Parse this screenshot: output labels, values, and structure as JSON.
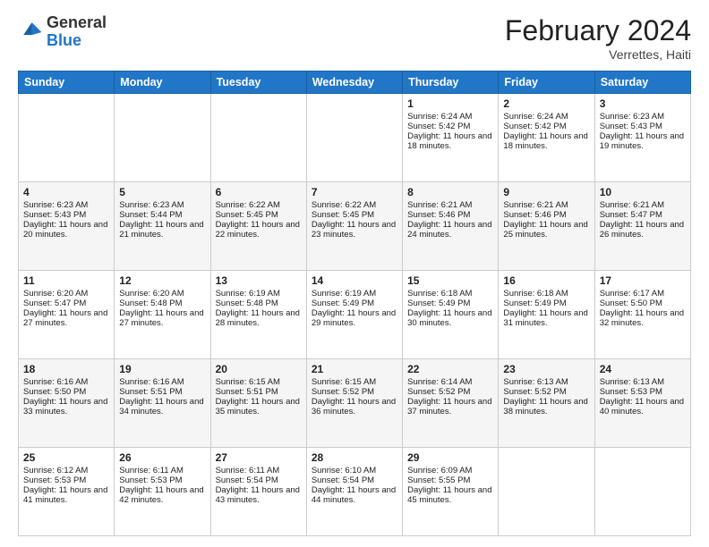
{
  "header": {
    "logo_general": "General",
    "logo_blue": "Blue",
    "title": "February 2024",
    "subtitle": "Verrettes, Haiti"
  },
  "days_of_week": [
    "Sunday",
    "Monday",
    "Tuesday",
    "Wednesday",
    "Thursday",
    "Friday",
    "Saturday"
  ],
  "weeks": [
    [
      {
        "day": "",
        "info": ""
      },
      {
        "day": "",
        "info": ""
      },
      {
        "day": "",
        "info": ""
      },
      {
        "day": "",
        "info": ""
      },
      {
        "day": "1",
        "info": "Sunrise: 6:24 AM\nSunset: 5:42 PM\nDaylight: 11 hours and 18 minutes."
      },
      {
        "day": "2",
        "info": "Sunrise: 6:24 AM\nSunset: 5:42 PM\nDaylight: 11 hours and 18 minutes."
      },
      {
        "day": "3",
        "info": "Sunrise: 6:23 AM\nSunset: 5:43 PM\nDaylight: 11 hours and 19 minutes."
      }
    ],
    [
      {
        "day": "4",
        "info": "Sunrise: 6:23 AM\nSunset: 5:43 PM\nDaylight: 11 hours and 20 minutes."
      },
      {
        "day": "5",
        "info": "Sunrise: 6:23 AM\nSunset: 5:44 PM\nDaylight: 11 hours and 21 minutes."
      },
      {
        "day": "6",
        "info": "Sunrise: 6:22 AM\nSunset: 5:45 PM\nDaylight: 11 hours and 22 minutes."
      },
      {
        "day": "7",
        "info": "Sunrise: 6:22 AM\nSunset: 5:45 PM\nDaylight: 11 hours and 23 minutes."
      },
      {
        "day": "8",
        "info": "Sunrise: 6:21 AM\nSunset: 5:46 PM\nDaylight: 11 hours and 24 minutes."
      },
      {
        "day": "9",
        "info": "Sunrise: 6:21 AM\nSunset: 5:46 PM\nDaylight: 11 hours and 25 minutes."
      },
      {
        "day": "10",
        "info": "Sunrise: 6:21 AM\nSunset: 5:47 PM\nDaylight: 11 hours and 26 minutes."
      }
    ],
    [
      {
        "day": "11",
        "info": "Sunrise: 6:20 AM\nSunset: 5:47 PM\nDaylight: 11 hours and 27 minutes."
      },
      {
        "day": "12",
        "info": "Sunrise: 6:20 AM\nSunset: 5:48 PM\nDaylight: 11 hours and 27 minutes."
      },
      {
        "day": "13",
        "info": "Sunrise: 6:19 AM\nSunset: 5:48 PM\nDaylight: 11 hours and 28 minutes."
      },
      {
        "day": "14",
        "info": "Sunrise: 6:19 AM\nSunset: 5:49 PM\nDaylight: 11 hours and 29 minutes."
      },
      {
        "day": "15",
        "info": "Sunrise: 6:18 AM\nSunset: 5:49 PM\nDaylight: 11 hours and 30 minutes."
      },
      {
        "day": "16",
        "info": "Sunrise: 6:18 AM\nSunset: 5:49 PM\nDaylight: 11 hours and 31 minutes."
      },
      {
        "day": "17",
        "info": "Sunrise: 6:17 AM\nSunset: 5:50 PM\nDaylight: 11 hours and 32 minutes."
      }
    ],
    [
      {
        "day": "18",
        "info": "Sunrise: 6:16 AM\nSunset: 5:50 PM\nDaylight: 11 hours and 33 minutes."
      },
      {
        "day": "19",
        "info": "Sunrise: 6:16 AM\nSunset: 5:51 PM\nDaylight: 11 hours and 34 minutes."
      },
      {
        "day": "20",
        "info": "Sunrise: 6:15 AM\nSunset: 5:51 PM\nDaylight: 11 hours and 35 minutes."
      },
      {
        "day": "21",
        "info": "Sunrise: 6:15 AM\nSunset: 5:52 PM\nDaylight: 11 hours and 36 minutes."
      },
      {
        "day": "22",
        "info": "Sunrise: 6:14 AM\nSunset: 5:52 PM\nDaylight: 11 hours and 37 minutes."
      },
      {
        "day": "23",
        "info": "Sunrise: 6:13 AM\nSunset: 5:52 PM\nDaylight: 11 hours and 38 minutes."
      },
      {
        "day": "24",
        "info": "Sunrise: 6:13 AM\nSunset: 5:53 PM\nDaylight: 11 hours and 40 minutes."
      }
    ],
    [
      {
        "day": "25",
        "info": "Sunrise: 6:12 AM\nSunset: 5:53 PM\nDaylight: 11 hours and 41 minutes."
      },
      {
        "day": "26",
        "info": "Sunrise: 6:11 AM\nSunset: 5:53 PM\nDaylight: 11 hours and 42 minutes."
      },
      {
        "day": "27",
        "info": "Sunrise: 6:11 AM\nSunset: 5:54 PM\nDaylight: 11 hours and 43 minutes."
      },
      {
        "day": "28",
        "info": "Sunrise: 6:10 AM\nSunset: 5:54 PM\nDaylight: 11 hours and 44 minutes."
      },
      {
        "day": "29",
        "info": "Sunrise: 6:09 AM\nSunset: 5:55 PM\nDaylight: 11 hours and 45 minutes."
      },
      {
        "day": "",
        "info": ""
      },
      {
        "day": "",
        "info": ""
      }
    ]
  ]
}
